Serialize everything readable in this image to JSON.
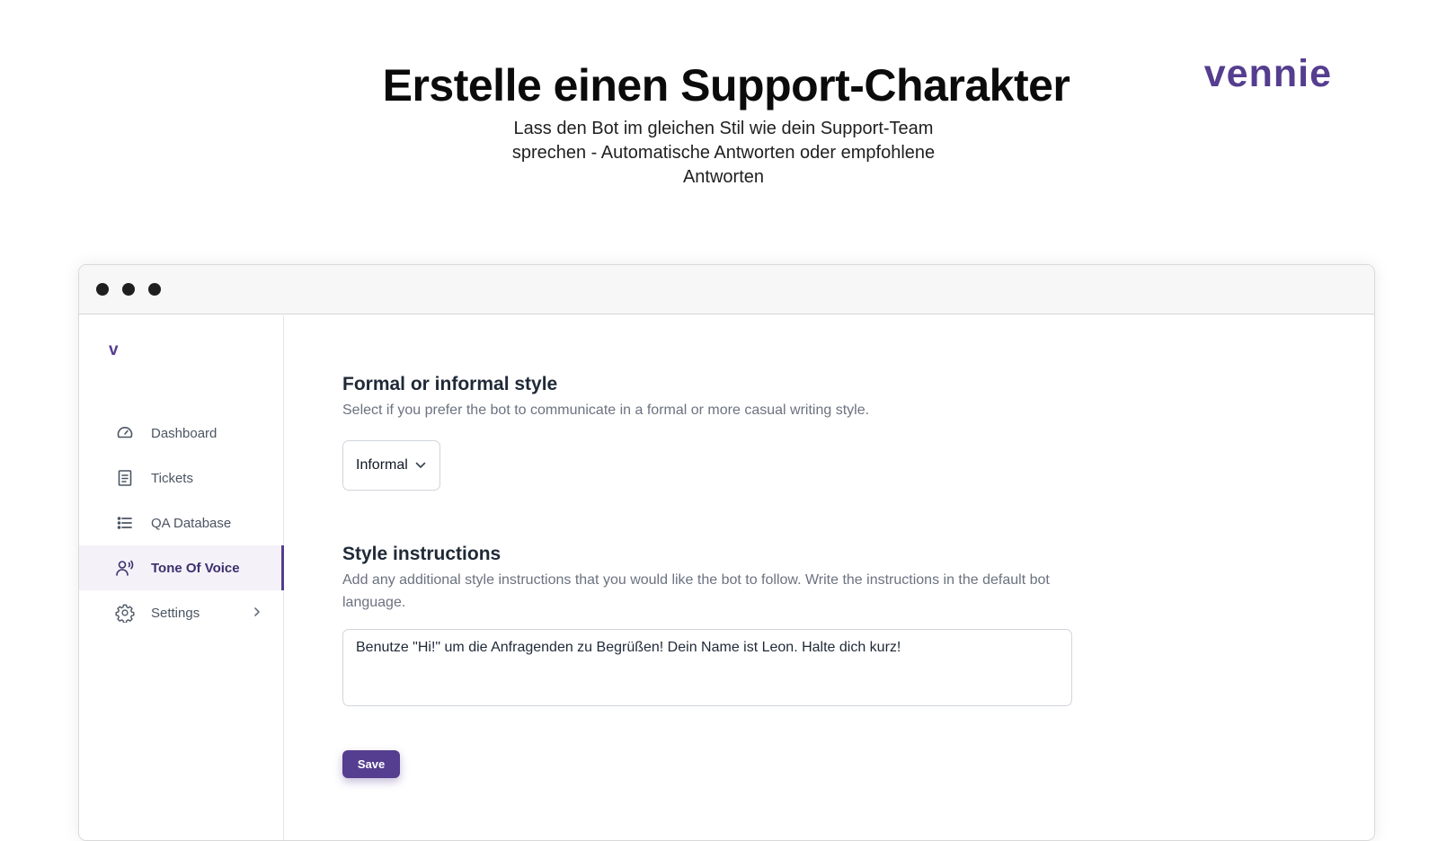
{
  "hero": {
    "title": "Erstelle einen Support-Charakter",
    "subtitle": "Lass den Bot im gleichen Stil wie dein Support-Team sprechen - Automatische Antworten oder empfohlene Antworten"
  },
  "brand": {
    "logo_text": "vennie",
    "color": "#553d8f"
  },
  "app": {
    "sidebar": {
      "logo_text": "v",
      "items": [
        {
          "label": "Dashboard",
          "icon": "gauge-icon"
        },
        {
          "label": "Tickets",
          "icon": "document-icon"
        },
        {
          "label": "QA Database",
          "icon": "list-icon"
        },
        {
          "label": "Tone Of Voice",
          "icon": "voice-icon",
          "active": true
        },
        {
          "label": "Settings",
          "icon": "gear-icon",
          "has_submenu": true
        }
      ]
    },
    "formality": {
      "title": "Formal or informal style",
      "description": "Select if you prefer the bot to communicate in a formal or more casual writing style.",
      "selected": "Informal"
    },
    "style": {
      "title": "Style instructions",
      "description": "Add any additional style instructions that you would like the bot to follow. Write the instructions in the default bot language.",
      "value": "Benutze \"Hi!\" um die Anfragenden zu Begrüßen! Dein Name ist Leon. Halte dich kurz!"
    },
    "save_label": "Save"
  }
}
